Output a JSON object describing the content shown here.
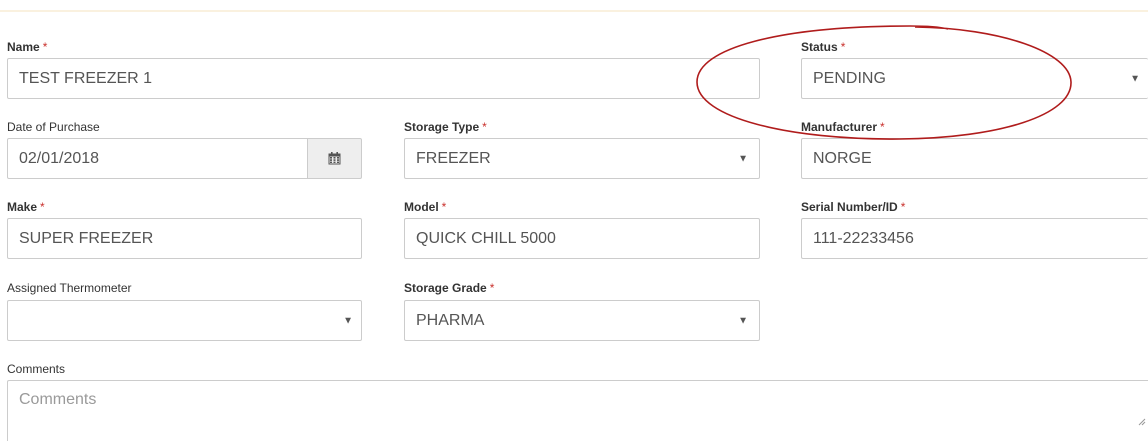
{
  "form": {
    "name": {
      "label": "Name",
      "required": "*",
      "value": "TEST FREEZER 1"
    },
    "status": {
      "label": "Status",
      "required": "*",
      "value": "PENDING",
      "caret": "▼"
    },
    "date_of_purchase": {
      "label": "Date of Purchase",
      "value": "02/01/2018",
      "icon": "calendar-icon"
    },
    "storage_type": {
      "label": "Storage Type",
      "required": "*",
      "value": "FREEZER",
      "caret": "▼"
    },
    "manufacturer": {
      "label": "Manufacturer",
      "required": "*",
      "value": "NORGE"
    },
    "make": {
      "label": "Make",
      "required": "*",
      "value": "SUPER FREEZER"
    },
    "model": {
      "label": "Model",
      "required": "*",
      "value": "QUICK CHILL 5000"
    },
    "serial_number": {
      "label": "Serial Number/ID",
      "required": "*",
      "value": "111-22233456"
    },
    "assigned_thermometer": {
      "label": "Assigned Thermometer",
      "value": "",
      "caret": "▼"
    },
    "storage_grade": {
      "label": "Storage Grade",
      "required": "*",
      "value": "PHARMA",
      "caret": "▼"
    },
    "comments": {
      "label": "Comments",
      "placeholder": "Comments"
    }
  },
  "colors": {
    "required": "#c9302c",
    "annotation": "#b01c1c",
    "border": "#cccccc",
    "addon": "#eeeeee"
  }
}
